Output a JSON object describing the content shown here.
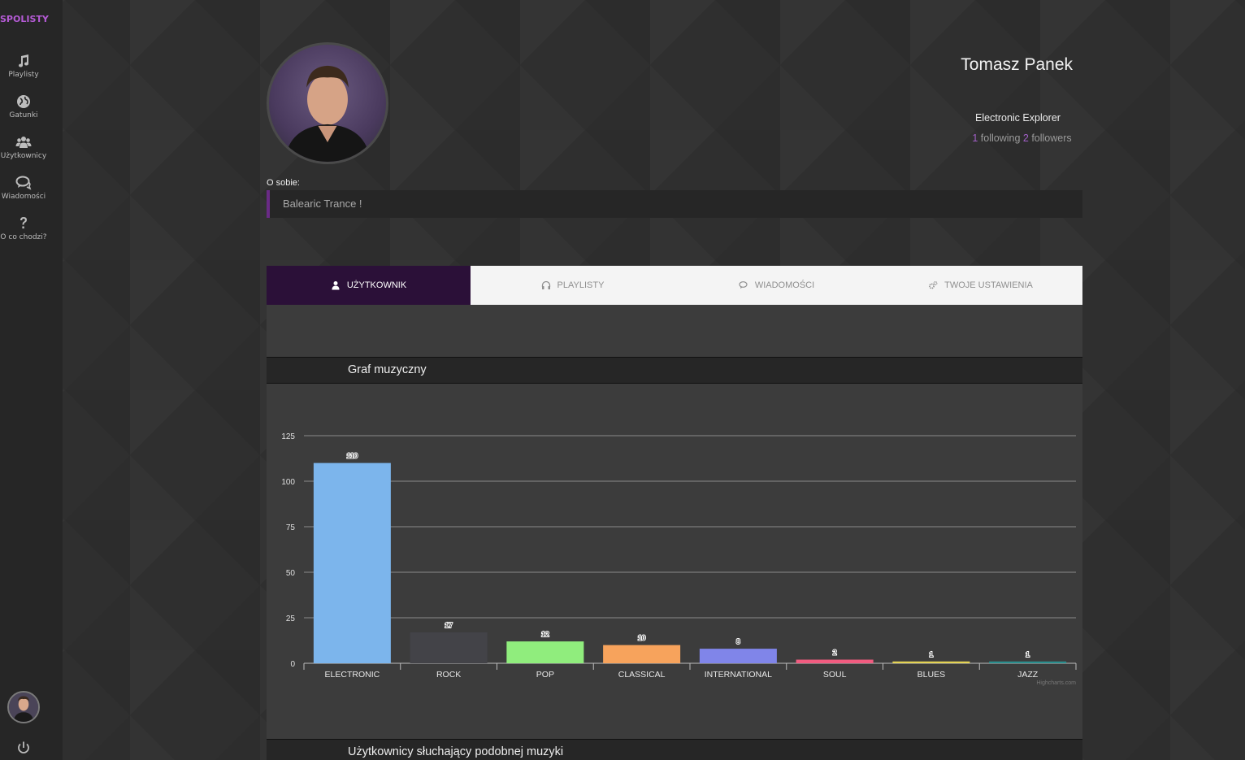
{
  "sidebar": {
    "brand": "SPOLISTY",
    "items": [
      {
        "label": "Playlisty",
        "icon": "music-note-icon"
      },
      {
        "label": "Gatunki",
        "icon": "globe-icon"
      },
      {
        "label": "Użytkownicy",
        "icon": "users-icon"
      },
      {
        "label": "Wiadomości",
        "icon": "chat-icon"
      },
      {
        "label": "O co chodzi?",
        "icon": "question-icon"
      }
    ]
  },
  "profile": {
    "name": "Tomasz Panek",
    "rank": "Electronic Explorer",
    "following_count": "1",
    "following_label": " following ",
    "followers_count": "2",
    "followers_label": " followers",
    "about_label": "O sobie:",
    "about_text": "Balearic Trance !"
  },
  "tabs": [
    {
      "label": "UŻYTKOWNIK",
      "icon": "user-icon",
      "active": true
    },
    {
      "label": "PLAYLISTY",
      "icon": "headphones-icon",
      "active": false
    },
    {
      "label": "WIADOMOŚCI",
      "icon": "chat-icon",
      "active": false
    },
    {
      "label": "TWOJE USTAWIENIA",
      "icon": "gears-icon",
      "active": false
    }
  ],
  "sections": {
    "graph_title": "Graf muzyczny",
    "similar_title": "Użytkownicy słuchający podobnej muzyki"
  },
  "chart_data": {
    "type": "bar",
    "title": "",
    "xlabel": "",
    "ylabel": "",
    "categories": [
      "ELECTRONIC",
      "ROCK",
      "POP",
      "CLASSICAL",
      "INTERNATIONAL",
      "SOUL",
      "BLUES",
      "JAZZ"
    ],
    "values": [
      110,
      17,
      12,
      10,
      8,
      2,
      1,
      1
    ],
    "colors": [
      "#7cb5ec",
      "#434348",
      "#90ed7d",
      "#f7a35c",
      "#8085e9",
      "#f15c80",
      "#e4d354",
      "#2b908f"
    ],
    "ylim": [
      0,
      125
    ],
    "yticks": [
      0,
      25,
      50,
      75,
      100,
      125
    ],
    "grid": true,
    "data_labels": true,
    "credits": "Highcharts.com"
  }
}
